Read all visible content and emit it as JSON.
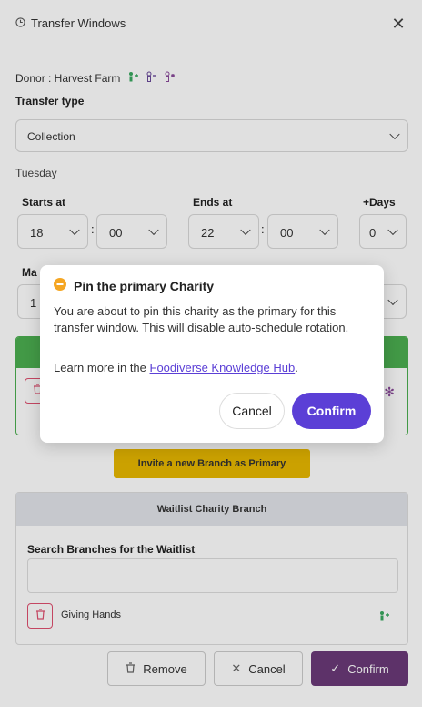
{
  "header": {
    "title": "Transfer Windows"
  },
  "donor": {
    "label": "Donor : Harvest Farm"
  },
  "transfer_type": {
    "label": "Transfer type",
    "value": "Collection"
  },
  "day": {
    "label": "Tuesday"
  },
  "time": {
    "starts_label": "Starts at",
    "starts_hour": "18",
    "starts_min": "00",
    "ends_label": "Ends at",
    "ends_hour": "22",
    "ends_min": "00",
    "days_label": "+Days",
    "days_value": "0",
    "separator": ":"
  },
  "max": {
    "label": "Ma",
    "value": "1"
  },
  "invite": {
    "label": "Invite a new Branch as Primary"
  },
  "waitlist": {
    "title": "Waitlist Charity Branch",
    "search_label": "Search Branches for the Waitlist",
    "search_placeholder": "",
    "item": "Giving Hands"
  },
  "footer": {
    "remove": "Remove",
    "cancel": "Cancel",
    "confirm": "Confirm"
  },
  "modal": {
    "title": "Pin the primary Charity",
    "body": "You are about to pin this charity as the primary for this transfer window. This will disable auto-schedule rotation.",
    "link_prefix": "Learn more in the ",
    "link": "Foodiverse Knowledge Hub",
    "link_suffix": ".",
    "cancel": "Cancel",
    "confirm": "Confirm"
  },
  "colors": {
    "primary": "#5b3fd6",
    "confirm_footer": "#6a3a78",
    "invite": "#e8b800",
    "green": "#4caf50",
    "danger": "#e05070",
    "warning": "#f5a623"
  }
}
